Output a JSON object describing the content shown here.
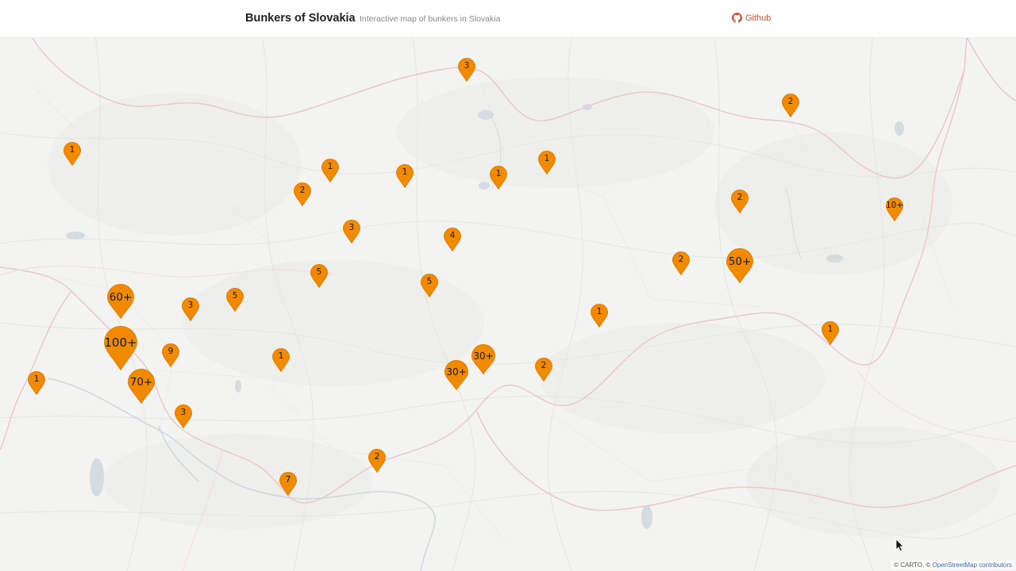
{
  "header": {
    "title": "Bunkers of Slovakia",
    "tagline": "Interactive map of bunkers in Slovakia",
    "github_label": "Github",
    "github_icon": "github-icon"
  },
  "colors": {
    "marker_fill": "#f28a00",
    "marker_stroke": "#e07d00",
    "accent": "#c8573a",
    "map_background": "#f3f3f1",
    "border": "#e8c6c6",
    "river": "#c9d3dc"
  },
  "map": {
    "markers": [
      {
        "label": "3"
      },
      {
        "label": "2"
      },
      {
        "label": "1"
      },
      {
        "label": "1"
      },
      {
        "label": "2"
      },
      {
        "label": "1"
      },
      {
        "label": "1"
      },
      {
        "label": "1"
      },
      {
        "label": "2"
      },
      {
        "label": "10+"
      },
      {
        "label": "3"
      },
      {
        "label": "4"
      },
      {
        "label": "2"
      },
      {
        "label": "50+"
      },
      {
        "label": "5"
      },
      {
        "label": "5"
      },
      {
        "label": "60+"
      },
      {
        "label": "3"
      },
      {
        "label": "5"
      },
      {
        "label": "1"
      },
      {
        "label": "1"
      },
      {
        "label": "100+"
      },
      {
        "label": "9"
      },
      {
        "label": "1"
      },
      {
        "label": "30+"
      },
      {
        "label": "30+"
      },
      {
        "label": "2"
      },
      {
        "label": "1"
      },
      {
        "label": "70+"
      },
      {
        "label": "3"
      },
      {
        "label": "2"
      },
      {
        "label": "7"
      }
    ],
    "attribution_prefix": "© CARTO, © ",
    "attribution_link": "OpenStreetMap contributors"
  }
}
